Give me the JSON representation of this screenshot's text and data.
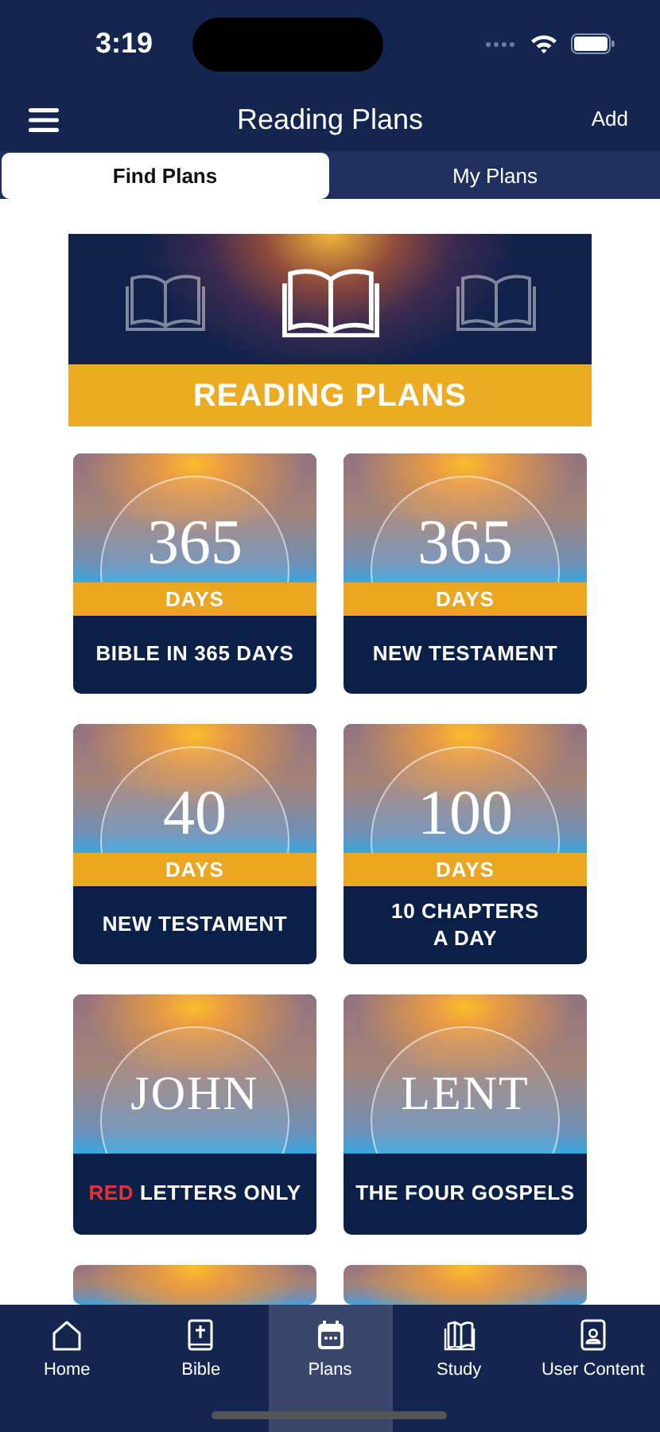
{
  "status_bar": {
    "time": "3:19"
  },
  "nav": {
    "title": "Reading Plans",
    "action": "Add"
  },
  "tabs": [
    {
      "label": "Find Plans",
      "selected": true
    },
    {
      "label": "My Plans",
      "selected": false
    }
  ],
  "banner": {
    "title": "READING PLANS"
  },
  "plans": [
    {
      "kind": "days",
      "number": "365",
      "unit": "DAYS",
      "title": "BIBLE IN 365 DAYS"
    },
    {
      "kind": "days",
      "number": "365",
      "unit": "DAYS",
      "title": "NEW TESTAMENT"
    },
    {
      "kind": "days",
      "number": "40",
      "unit": "DAYS",
      "title": "NEW TESTAMENT"
    },
    {
      "kind": "days",
      "number": "100",
      "unit": "DAYS",
      "title": "10 CHAPTERS\nA DAY"
    },
    {
      "kind": "book",
      "name": "JOHN",
      "highlight": "RED",
      "title": "LETTERS ONLY"
    },
    {
      "kind": "book",
      "name": "LENT",
      "title": "THE FOUR GOSPELS"
    },
    {
      "kind": "picture"
    },
    {
      "kind": "picture"
    }
  ],
  "bottom_nav": [
    {
      "label": "Home",
      "selected": false
    },
    {
      "label": "Bible",
      "selected": false
    },
    {
      "label": "Plans",
      "selected": true
    },
    {
      "label": "Study",
      "selected": false
    },
    {
      "label": "User Content",
      "selected": false
    }
  ]
}
